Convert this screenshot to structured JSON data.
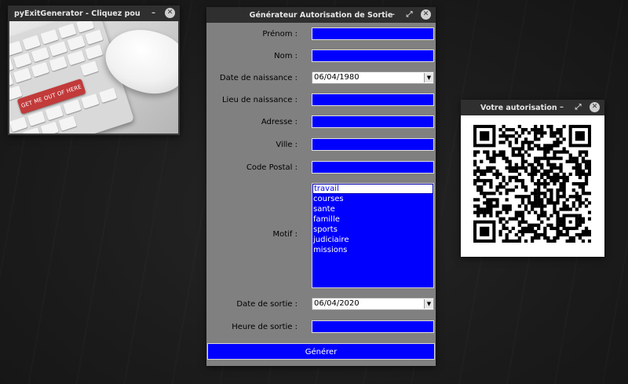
{
  "window1": {
    "title": "pyExitGenerator - Cliquez pour ...",
    "controls": {
      "minimize": "–",
      "close": "✕"
    },
    "image_text": "GET ME OUT OF HERE"
  },
  "window2": {
    "title": "Générateur Autorisation de Sortie",
    "controls": {
      "minimize": "–",
      "restore": "⤢",
      "close": "✕"
    },
    "fields": {
      "prenom": {
        "label": "Prénom :",
        "value": ""
      },
      "nom": {
        "label": "Nom :",
        "value": ""
      },
      "date_naissance": {
        "label": "Date de naissance :",
        "value": "06/04/1980"
      },
      "lieu_naissance": {
        "label": "Lieu de naissance :",
        "value": ""
      },
      "adresse": {
        "label": "Adresse :",
        "value": ""
      },
      "ville": {
        "label": "Ville :",
        "value": ""
      },
      "code_postal": {
        "label": "Code Postal :",
        "value": ""
      },
      "motif": {
        "label": "Motif :",
        "options": [
          "travail",
          "courses",
          "sante",
          "famille",
          "sports",
          "judiciaire",
          "missions"
        ],
        "selected": "travail"
      },
      "date_sortie": {
        "label": "Date de sortie :",
        "value": "06/04/2020"
      },
      "heure_sortie": {
        "label": "Heure de sortie :",
        "value": ""
      }
    },
    "generate_label": "Générer",
    "colors": {
      "entry_bg": "#0000ff",
      "window_bg": "#808080"
    }
  },
  "window3": {
    "title": "Votre autorisation",
    "controls": {
      "minimize": "–",
      "restore": "⤢",
      "close": "✕"
    }
  }
}
